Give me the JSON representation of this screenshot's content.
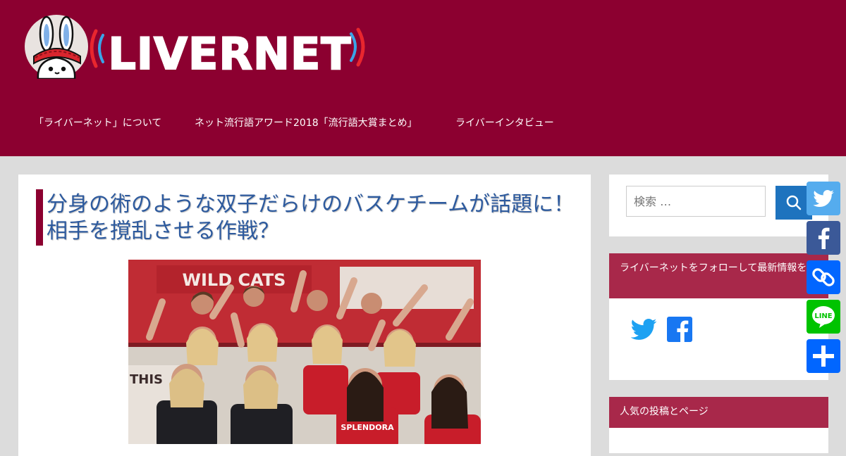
{
  "site": {
    "logo_text": "LIVERNET"
  },
  "nav": {
    "items": [
      {
        "label": "「ライバーネット」について"
      },
      {
        "label": "ネット流行語アワード2018「流行語大賞まとめ」"
      },
      {
        "label": "ライバーインタビュー"
      }
    ]
  },
  "article": {
    "title": "分身の術のような双子だらけのバスケチームが話題に！　相手を撹乱させる作戦？",
    "image": {
      "banner_text": "WILD CATS",
      "wall_text": "THIS",
      "jersey_text": "SPLENDORA"
    }
  },
  "sidebar": {
    "search": {
      "placeholder": "検索 …"
    },
    "follow": {
      "heading": "ライバーネットをフォローして最新情報を"
    },
    "popular": {
      "heading": "人気の投稿とページ"
    }
  },
  "share": {
    "buttons": [
      {
        "name": "twitter",
        "color": "#55acee"
      },
      {
        "name": "facebook",
        "color": "#3b5998"
      },
      {
        "name": "copy-link",
        "color": "#0166ff"
      },
      {
        "name": "line",
        "color": "#00c300"
      },
      {
        "name": "share",
        "color": "#0166ff"
      }
    ]
  },
  "colors": {
    "header": "#8c0030",
    "widget_head": "#a8284a",
    "title": "#2d5a9e",
    "search_button": "#1e73be",
    "twitter": "#1da1f2",
    "facebook": "#1877f2"
  }
}
